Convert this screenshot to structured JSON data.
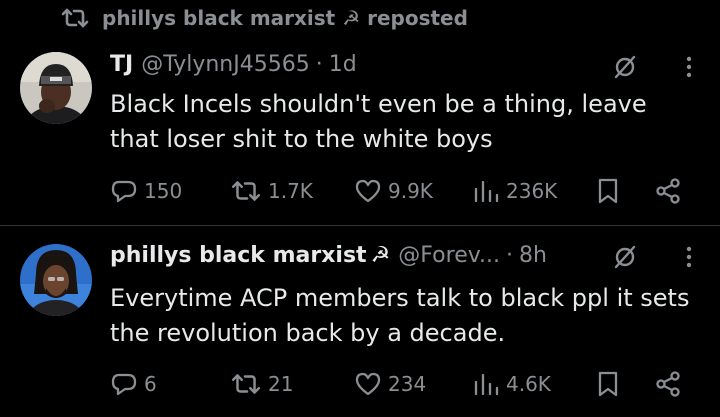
{
  "repost": {
    "icon": "repost-icon",
    "label": "phillys black marxist ☭ reposted"
  },
  "posts": [
    {
      "author_name": "TJ",
      "author_handle": "@TylynnJ45565",
      "separator": "·",
      "time": "1d",
      "avatar": "avatar-photo-man-in-beanie",
      "text": "Black Incels shouldn't even be a thing, leave that loser shit to the white boys",
      "replies": "150",
      "reposts": "1.7K",
      "likes": "9.9K",
      "views": "236K"
    },
    {
      "author_name": "phillys black marxist",
      "name_emoji": "☭",
      "author_handle": "@Forev...",
      "separator": "·",
      "time": "8h",
      "avatar": "avatar-photo-man-with-locs",
      "text": "Everytime ACP members talk to black ppl it sets the revolution back by a decade.",
      "replies": "6",
      "reposts": "21",
      "likes": "234",
      "views": "4.6K"
    }
  ],
  "colors": {
    "background": "#000000",
    "text": "#e7e9ea",
    "secondary": "#8b8f93",
    "divider": "#2f3336"
  }
}
